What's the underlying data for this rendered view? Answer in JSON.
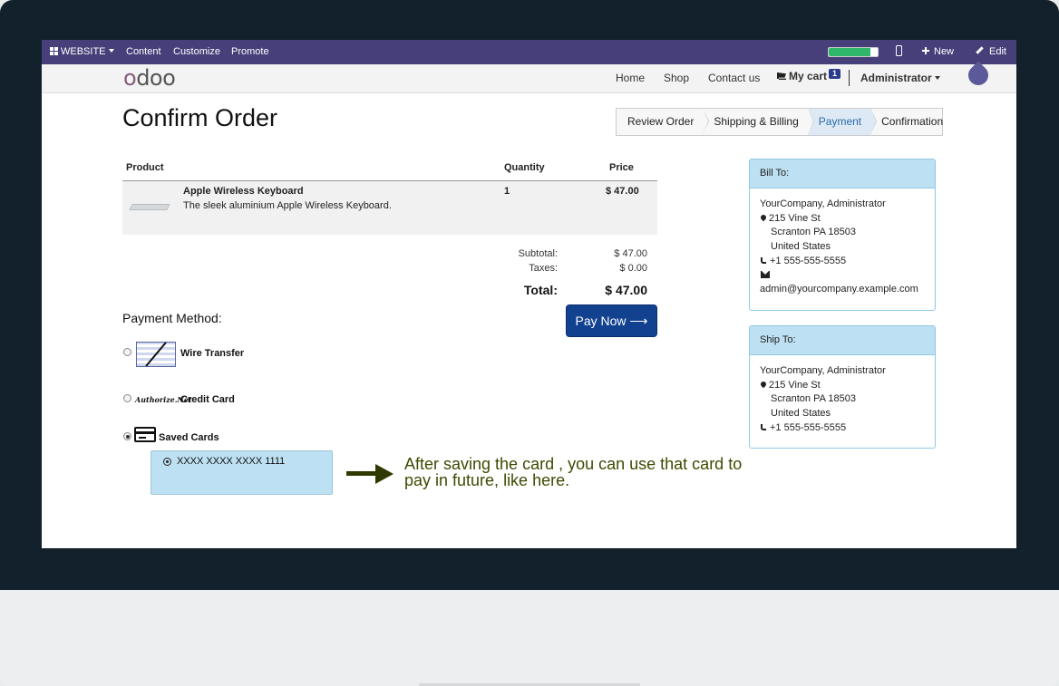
{
  "topbar": {
    "website": "WEBSITE",
    "content": "Content",
    "customize": "Customize",
    "promote": "Promote",
    "progress_fraction": 0.85,
    "new": "New",
    "edit": "Edit"
  },
  "navbar": {
    "logo": "odoo",
    "home": "Home",
    "shop": "Shop",
    "contact": "Contact us",
    "cart": "My cart",
    "cart_count": "1",
    "user": "Administrator"
  },
  "page": {
    "title": "Confirm Order"
  },
  "wizard": [
    {
      "label": "Review Order",
      "active": false
    },
    {
      "label": "Shipping & Billing",
      "active": false
    },
    {
      "label": "Payment",
      "active": true
    },
    {
      "label": "Confirmation",
      "active": false
    }
  ],
  "order": {
    "headers": {
      "product": "Product",
      "quantity": "Quantity",
      "price": "Price"
    },
    "items": [
      {
        "name": "Apple Wireless Keyboard",
        "description": "The sleek aluminium Apple Wireless Keyboard.",
        "quantity": "1",
        "price": "$ 47.00"
      }
    ],
    "subtotal_label": "Subtotal:",
    "subtotal": "$ 47.00",
    "taxes_label": "Taxes:",
    "taxes": "$ 0.00",
    "total_label": "Total:",
    "total": "$ 47.00"
  },
  "payment": {
    "title": "Payment Method:",
    "pay_button": "Pay Now",
    "methods": [
      {
        "label": "Wire Transfer",
        "checked": false
      },
      {
        "label": "Credit Card",
        "checked": false,
        "logo_text": "Authorize.Net"
      },
      {
        "label": "Saved Cards",
        "checked": true
      }
    ],
    "saved_card": "XXXX XXXX XXXX 1111"
  },
  "annotation": "After saving the card , you can use that card to pay in future, like here.",
  "bill_to": {
    "title": "Bill To:",
    "name": "YourCompany, Administrator",
    "street": "215 Vine St",
    "city": "Scranton PA 18503",
    "country": "United States",
    "phone": "+1 555-555-5555",
    "email": "admin@yourcompany.example.com"
  },
  "ship_to": {
    "title": "Ship To:",
    "name": "YourCompany, Administrator",
    "street": "215 Vine St",
    "city": "Scranton PA 18503",
    "country": "United States",
    "phone": "+1 555-555-5555"
  }
}
